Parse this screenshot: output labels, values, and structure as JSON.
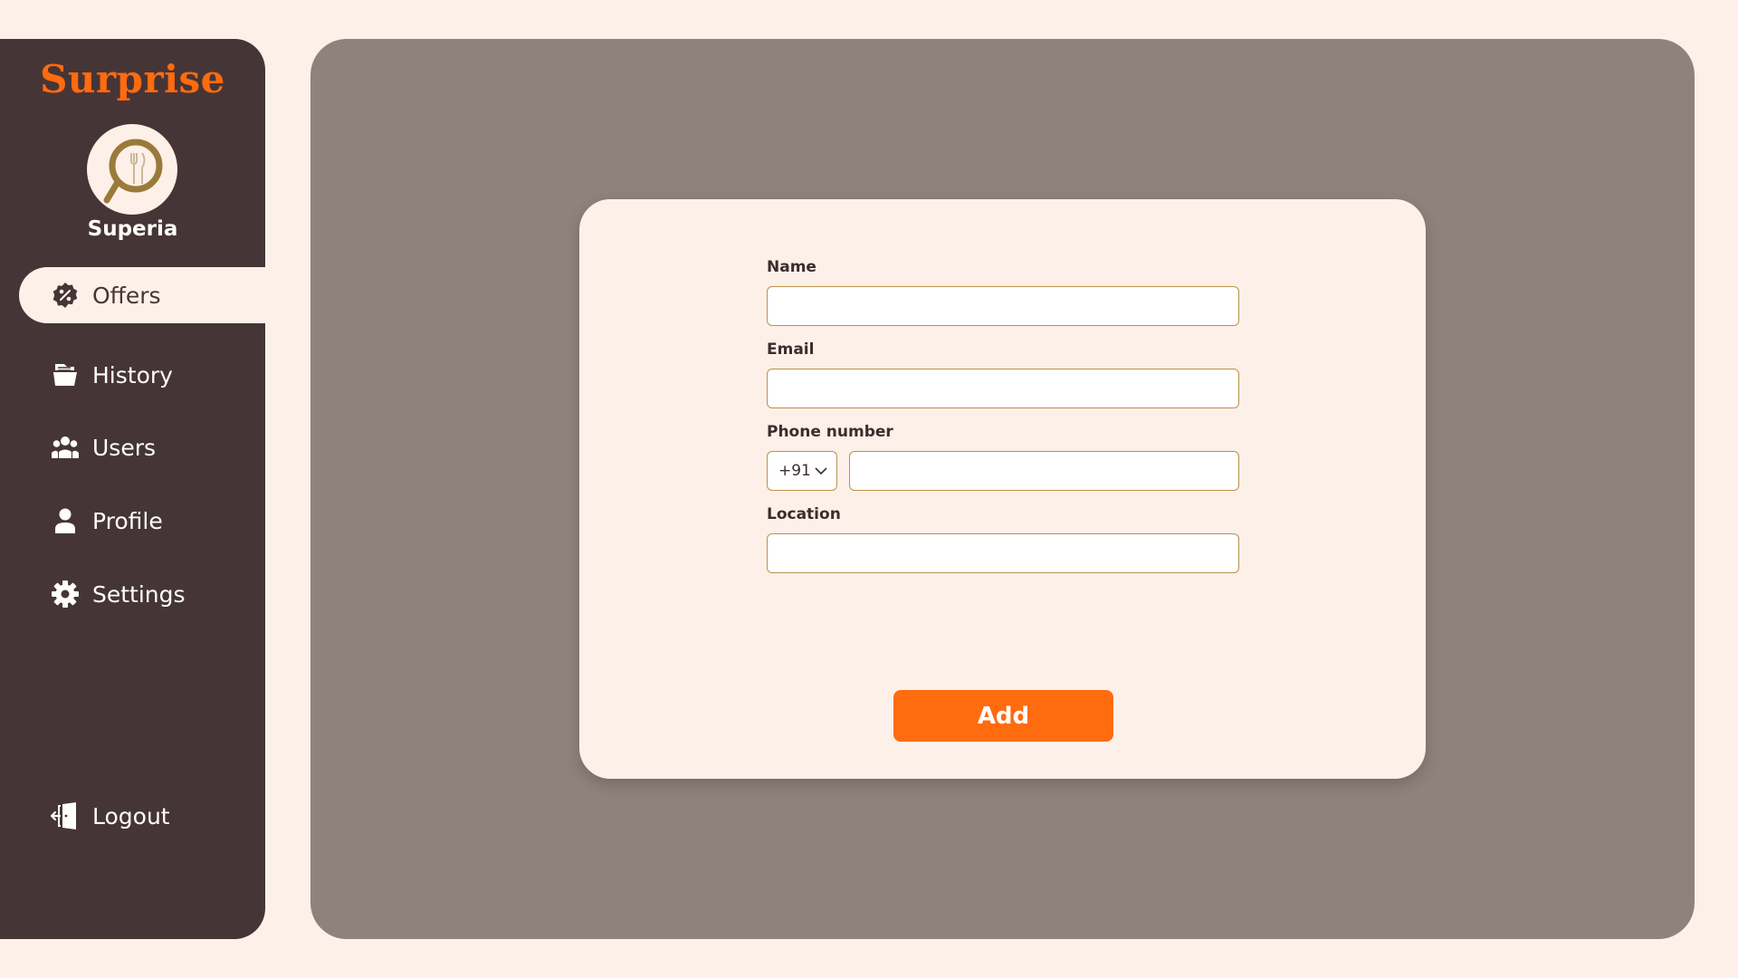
{
  "sidebar": {
    "brand": "Surprise",
    "restaurant_name": "Superia",
    "nav_items": [
      {
        "label": "Offers",
        "icon": "offer-percent-icon",
        "active": true
      },
      {
        "label": "History",
        "icon": "history-folder-icon",
        "active": false
      },
      {
        "label": "Users",
        "icon": "users-group-icon",
        "active": false
      },
      {
        "label": "Profile",
        "icon": "person-icon",
        "active": false
      },
      {
        "label": "Settings",
        "icon": "gear-icon",
        "active": false
      }
    ],
    "logout": {
      "label": "Logout",
      "icon": "logout-door-icon"
    }
  },
  "form": {
    "name": {
      "label": "Name",
      "value": ""
    },
    "email": {
      "label": "Email",
      "value": ""
    },
    "phone": {
      "label": "Phone number",
      "country_code": "+91",
      "value": ""
    },
    "location": {
      "label": "Location",
      "value": ""
    },
    "submit_label": "Add"
  },
  "colors": {
    "sidebar_bg": "#463536",
    "page_bg": "#fdf0e8",
    "panel_bg": "#8f827d",
    "accent": "#ff6b0f",
    "input_border": "#b8934a"
  }
}
